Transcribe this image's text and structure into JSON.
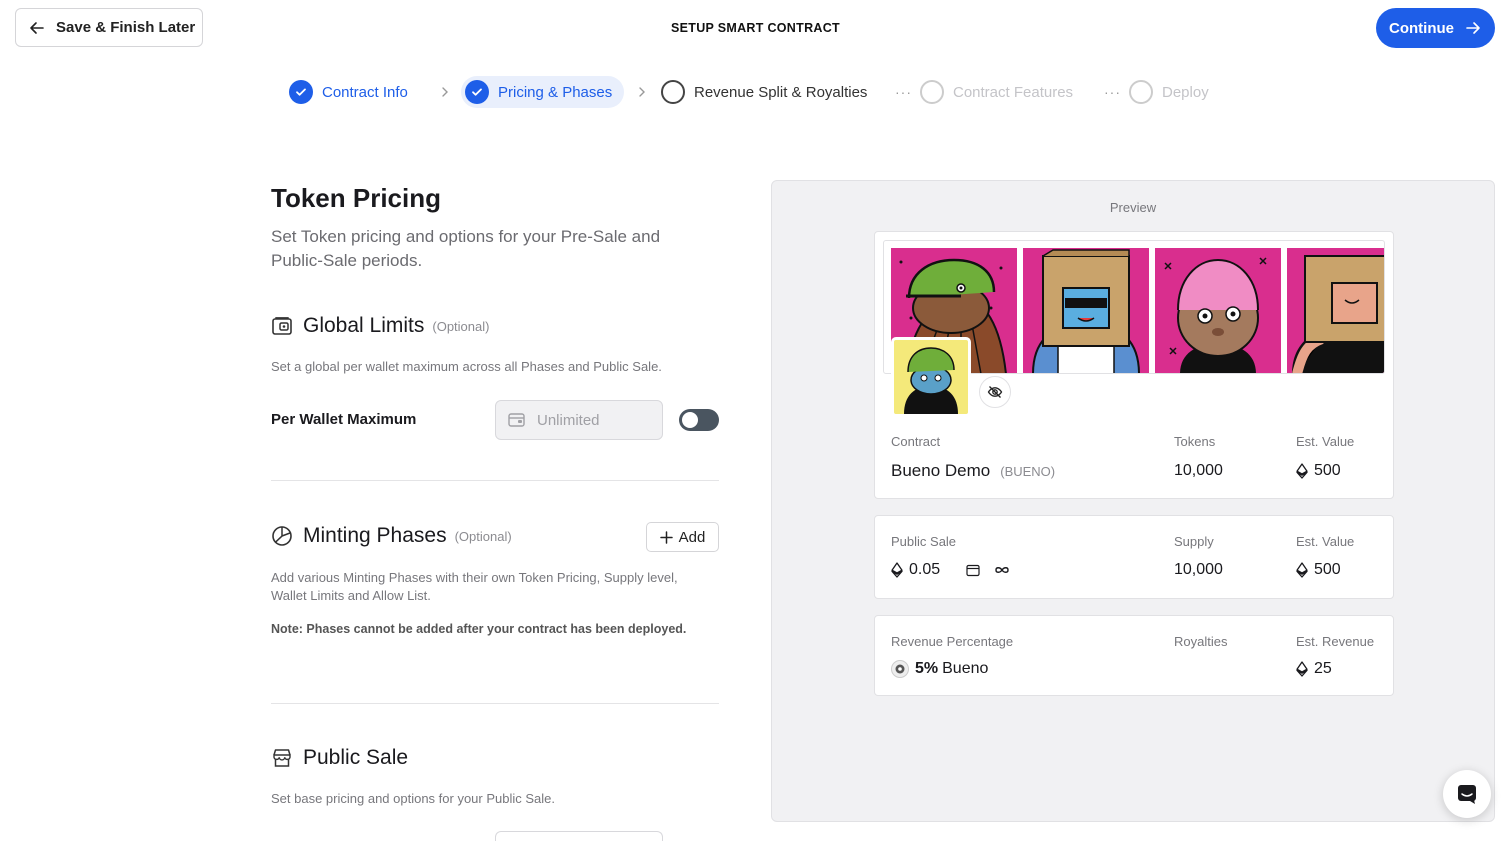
{
  "header": {
    "back_label": "Save & Finish Later",
    "title": "SETUP SMART CONTRACT",
    "continue_label": "Continue"
  },
  "steps": [
    {
      "label": "Contract Info",
      "state": "done"
    },
    {
      "label": "Pricing & Phases",
      "state": "done-active"
    },
    {
      "label": "Revenue Split & Royalties",
      "state": "current"
    },
    {
      "label": "Contract Features",
      "state": "future"
    },
    {
      "label": "Deploy",
      "state": "future"
    }
  ],
  "main": {
    "title": "Token Pricing",
    "subtitle": "Set Token pricing and options for your Pre-Sale and Public-Sale periods.",
    "global_limits": {
      "title": "Global Limits",
      "optional": "(Optional)",
      "description": "Set a global per wallet maximum across all Phases and Public Sale.",
      "field_label": "Per Wallet Maximum",
      "placeholder": "Unlimited",
      "toggle_on": false
    },
    "minting_phases": {
      "title": "Minting Phases",
      "optional": "(Optional)",
      "add_label": "Add",
      "description": "Add various Minting Phases with their own Token Pricing, Supply level, Wallet Limits and Allow List.",
      "note": "Note: Phases cannot be added after your contract has been deployed."
    },
    "public_sale": {
      "title": "Public Sale",
      "description": "Set base pricing and options for your Public Sale."
    }
  },
  "preview": {
    "title": "Preview",
    "contract_card": {
      "contract_label": "Contract",
      "contract_name": "Bueno Demo",
      "contract_symbol": "(BUENO)",
      "tokens_label": "Tokens",
      "tokens_value": "10,000",
      "value_label": "Est. Value",
      "value": "500"
    },
    "sale_card": {
      "sale_label": "Public Sale",
      "price": "0.05",
      "supply_label": "Supply",
      "supply_value": "10,000",
      "value_label": "Est. Value",
      "value": "500"
    },
    "revenue_card": {
      "revenue_label": "Revenue Percentage",
      "percent": "5%",
      "recipient": "Bueno",
      "royalties_label": "Royalties",
      "est_revenue_label": "Est. Revenue",
      "est_revenue": "25"
    }
  },
  "colors": {
    "accent": "#1e5ee8",
    "nft_pink": "#d92e8e"
  }
}
